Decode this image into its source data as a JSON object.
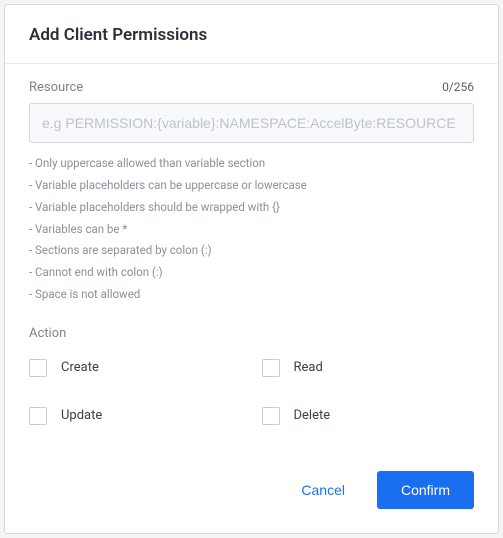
{
  "modal": {
    "title": "Add Client Permissions"
  },
  "resource": {
    "label": "Resource",
    "char_count": "0/256",
    "placeholder": "e.g PERMISSION:{variable}:NAMESPACE:AccelByte:RESOURCE",
    "value": "",
    "hints": [
      "- Only uppercase allowed than variable section",
      "- Variable placeholders can be uppercase or lowercase",
      "- Variable placeholders should be wrapped with {}",
      "- Variables can be *",
      "- Sections are separated by colon (:)",
      "- Cannot end with colon (:)",
      "- Space is not allowed"
    ]
  },
  "action": {
    "label": "Action",
    "options": [
      {
        "label": "Create"
      },
      {
        "label": "Read"
      },
      {
        "label": "Update"
      },
      {
        "label": "Delete"
      }
    ]
  },
  "footer": {
    "cancel": "Cancel",
    "confirm": "Confirm"
  }
}
